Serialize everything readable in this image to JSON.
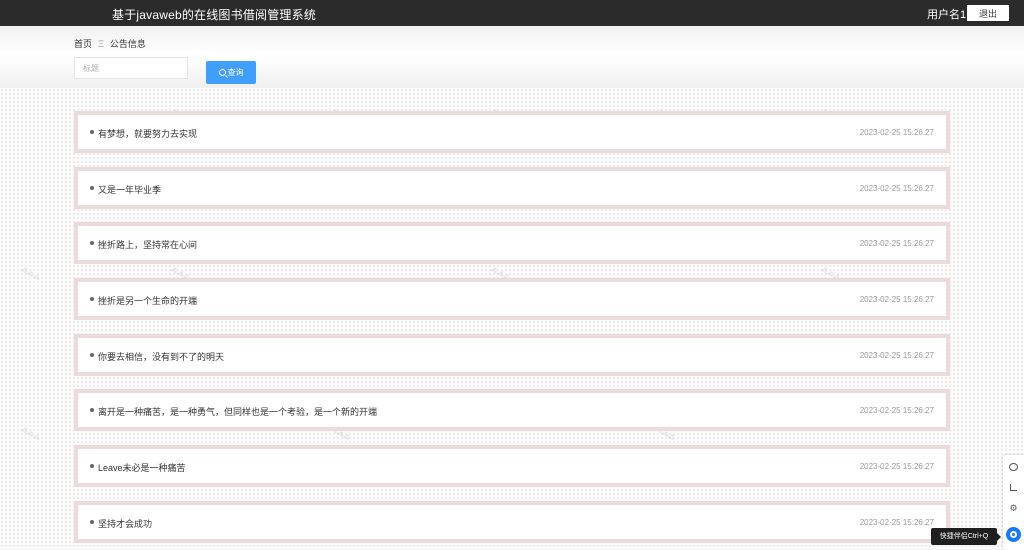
{
  "header": {
    "title": "基于javaweb的在线图书借阅管理系统",
    "username": "用户名1",
    "logout_label": "退出"
  },
  "breadcrumb": {
    "home": "首页",
    "separator": "Ξ",
    "current": "公告信息"
  },
  "filter": {
    "title_placeholder": "标题",
    "search_label": "查询"
  },
  "notices": [
    {
      "title": "有梦想，就要努力去实现",
      "time": "2023-02-25 15:26:27"
    },
    {
      "title": "又是一年毕业季",
      "time": "2023-02-25 15:26:27"
    },
    {
      "title": "挫折路上，坚持常在心间",
      "time": "2023-02-25 15:26:27"
    },
    {
      "title": "挫折是另一个生命的开端",
      "time": "2023-02-25 15:26:27"
    },
    {
      "title": "你要去相信，没有到不了的明天",
      "time": "2023-02-25 15:26:27"
    },
    {
      "title": "离开是一种痛苦，是一种勇气，但同样也是一个考验，是一个新的开端",
      "time": "2023-02-25 15:26:27"
    },
    {
      "title": "Leave未必是一种痛苦",
      "time": "2023-02-25 15:26:27"
    },
    {
      "title": "坚持才会成功",
      "time": "2023-02-25 15:26:27"
    }
  ],
  "side_tools": {
    "tooltip": "快捷伴侣Ctrl+Q",
    "icons": [
      "chat-icon",
      "crop-icon",
      "gear-icon",
      "assistant-icon"
    ]
  },
  "colors": {
    "header_bg": "#2b2b2b",
    "accent": "#409eff",
    "item_border": "#ecdbdb"
  }
}
